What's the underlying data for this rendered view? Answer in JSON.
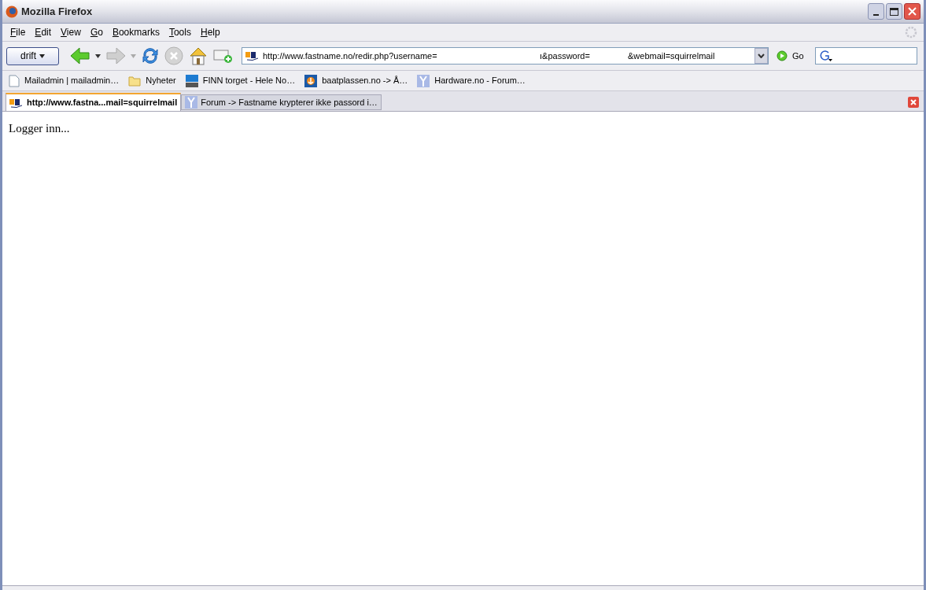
{
  "window": {
    "title": "Mozilla Firefox"
  },
  "menu": [
    "File",
    "Edit",
    "View",
    "Go",
    "Bookmarks",
    "Tools",
    "Help"
  ],
  "toolbar": {
    "profile_button": "drift",
    "url_segments": [
      "http://www.fastname.no/redir.php?username=",
      "ı&password=",
      "&webmail=squirrelmail"
    ],
    "go_button": "Go"
  },
  "bookmarks": [
    {
      "kind": "page",
      "label": "Mailadmin | mailadmin…"
    },
    {
      "kind": "folder",
      "label": "Nyheter"
    },
    {
      "kind": "finn",
      "label": "FINN torget - Hele No…"
    },
    {
      "kind": "anchor",
      "label": "baatplassen.no -> Å…"
    },
    {
      "kind": "hw",
      "label": "Hardware.no - Forum…"
    }
  ],
  "tabs": [
    {
      "label": "http://www.fastna...mail=squirrelmail",
      "selected": true,
      "kind": "fn"
    },
    {
      "label": "Forum -> Fastname krypterer ikke passord i…",
      "selected": false,
      "kind": "hw"
    }
  ],
  "content": {
    "text": "Logger inn..."
  }
}
